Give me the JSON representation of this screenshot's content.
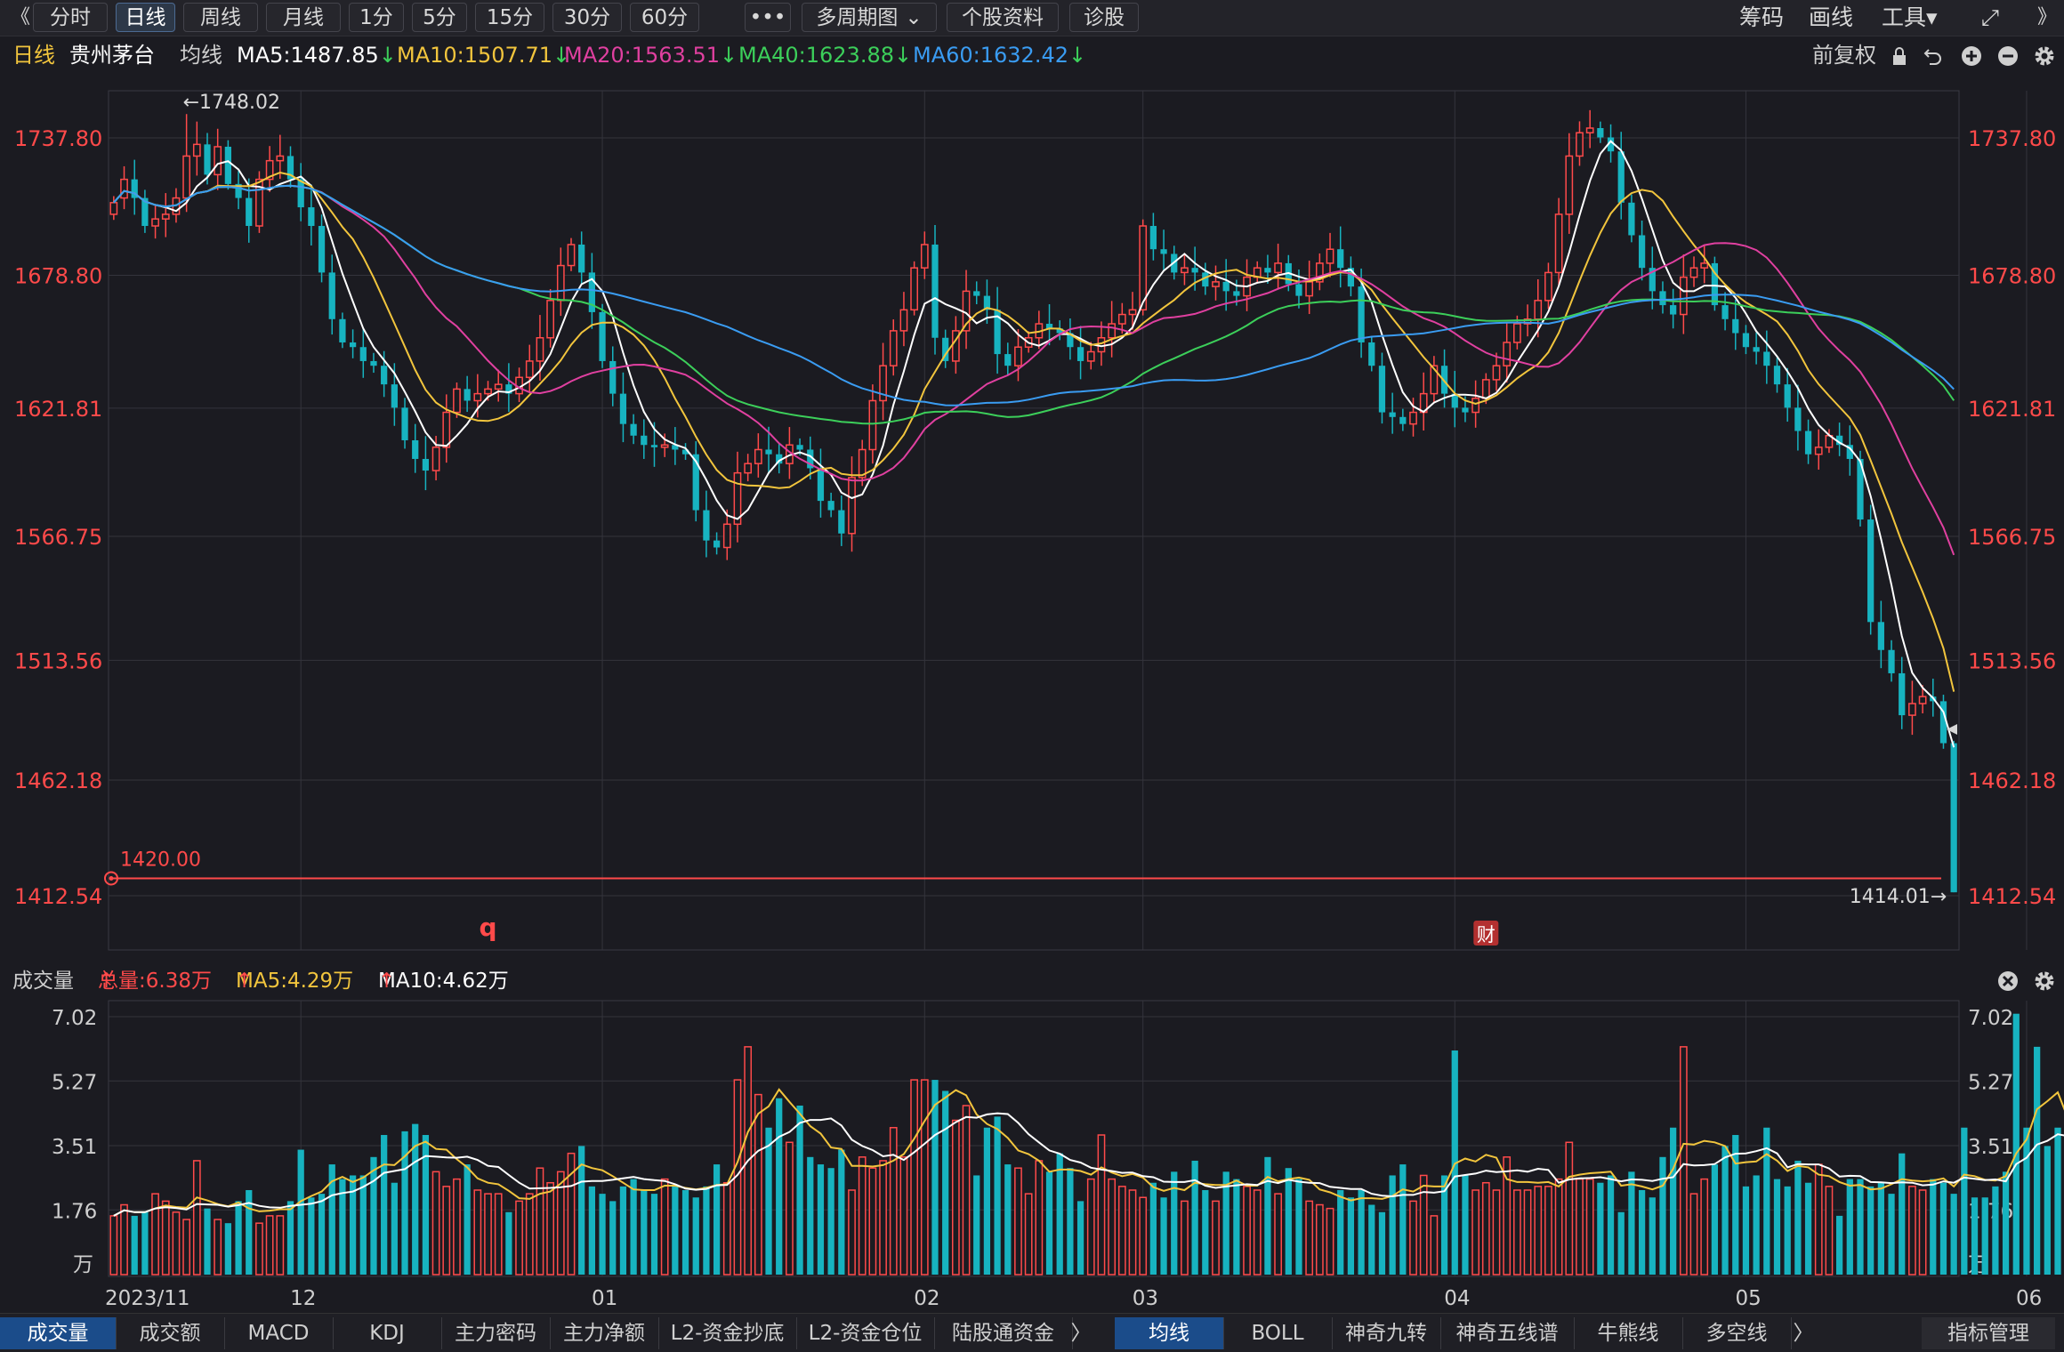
{
  "toolbar": {
    "back": "《",
    "periods": [
      "分时",
      "日线",
      "周线",
      "月线",
      "1分",
      "5分",
      "15分",
      "30分",
      "60分"
    ],
    "active_period": "日线",
    "more": "•••",
    "multi": "多周期图",
    "multi_arrow": "⌄",
    "profile": "个股资料",
    "diagnose": "诊股",
    "chips": "筹码",
    "draw": "画线",
    "tools": "工具",
    "tools_arrow": "▾",
    "expand": "⤢",
    "forward": "》"
  },
  "info": {
    "period": "日线",
    "stock": "贵州茅台",
    "avg_label": "均线",
    "ma": [
      {
        "label": "MA5:1487.85",
        "color": "#ffffff"
      },
      {
        "label": "MA10:1507.71",
        "color": "#f2c53d"
      },
      {
        "label": "MA20:1563.51",
        "color": "#e040a0"
      },
      {
        "label": "MA40:1623.88",
        "color": "#3ccf5a"
      },
      {
        "label": "MA60:1632.42",
        "color": "#3a9cf2"
      }
    ],
    "down_arrow": "↓",
    "adjust": "前复权"
  },
  "vol_info": {
    "title": "成交量",
    "total": "总量:6.38万",
    "ma5": "MA5:4.29万",
    "ma10": "MA10:4.62万",
    "up_arrow": "↑"
  },
  "colors": {
    "up": "#ff4a4a",
    "down": "#17b3c0",
    "grid": "#34343c",
    "bg": "#1b1b21",
    "ma5": "#ffffff",
    "ma10": "#f2c53d",
    "ma20": "#e040a0",
    "ma40": "#3ccf5a",
    "ma60": "#3a9cf2"
  },
  "chart_data": [
    {
      "type": "candlestick",
      "ylim": [
        1412.54,
        1737.8
      ],
      "yticks": [
        "1737.80",
        "1678.80",
        "1621.81",
        "1566.75",
        "1513.56",
        "1462.18",
        "1412.54"
      ],
      "months": [
        {
          "label": "2023/11",
          "index": 0
        },
        {
          "label": "12",
          "index": 18
        },
        {
          "label": "01",
          "index": 47
        },
        {
          "label": "02",
          "index": 78
        },
        {
          "label": "03",
          "index": 99
        },
        {
          "label": "04",
          "index": 129
        },
        {
          "label": "05",
          "index": 157
        },
        {
          "label": "06",
          "index": 184
        }
      ],
      "annotations": {
        "high_label": "←1748.02",
        "low_label": "1414.01→",
        "alert_price": 1420.0,
        "alert_label": "1420.00",
        "markers": [
          {
            "text": "q",
            "index": 36
          },
          {
            "text": "财",
            "index": 132
          },
          {
            "text": "q",
            "index": 200
          }
        ]
      },
      "close": [
        1710,
        1720,
        1712,
        1700,
        1703,
        1705,
        1712,
        1730,
        1735,
        1722,
        1734,
        1718,
        1712,
        1700,
        1720,
        1728,
        1730,
        1720,
        1708,
        1700,
        1680,
        1660,
        1650,
        1648,
        1642,
        1640,
        1632,
        1622,
        1608,
        1600,
        1595,
        1605,
        1620,
        1630,
        1625,
        1628,
        1630,
        1632,
        1628,
        1635,
        1642,
        1652,
        1668,
        1683,
        1692,
        1680,
        1663,
        1642,
        1628,
        1615,
        1610,
        1606,
        1605,
        1606,
        1604,
        1602,
        1578,
        1565,
        1562,
        1572,
        1594,
        1598,
        1604,
        1602,
        1598,
        1606,
        1604,
        1596,
        1582,
        1578,
        1568,
        1592,
        1604,
        1625,
        1640,
        1655,
        1664,
        1682,
        1692,
        1652,
        1642,
        1655,
        1672,
        1670,
        1664,
        1645,
        1640,
        1648,
        1652,
        1658,
        1656,
        1654,
        1648,
        1642,
        1646,
        1652,
        1658,
        1662,
        1664,
        1700,
        1690,
        1688,
        1680,
        1682,
        1680,
        1674,
        1676,
        1672,
        1670,
        1678,
        1682,
        1680,
        1684,
        1675,
        1670,
        1676,
        1684,
        1690,
        1682,
        1674,
        1650,
        1640,
        1620,
        1618,
        1615,
        1620,
        1628,
        1640,
        1628,
        1622,
        1620,
        1626,
        1634,
        1640,
        1650,
        1658,
        1660,
        1668,
        1680,
        1705,
        1730,
        1740,
        1742,
        1738,
        1732,
        1710,
        1696,
        1682,
        1672,
        1666,
        1662,
        1678,
        1682,
        1684,
        1666,
        1660,
        1654,
        1648,
        1646,
        1640,
        1632,
        1622,
        1612,
        1602,
        1605,
        1610,
        1606,
        1600,
        1574,
        1530,
        1518,
        1508,
        1490,
        1495,
        1498,
        1496,
        1478,
        1414
      ],
      "open": [
        1705,
        1712,
        1720,
        1712,
        1700,
        1703,
        1705,
        1712,
        1730,
        1735,
        1722,
        1734,
        1718,
        1712,
        1700,
        1720,
        1728,
        1730,
        1720,
        1708,
        1700,
        1680,
        1660,
        1650,
        1648,
        1642,
        1640,
        1632,
        1622,
        1608,
        1600,
        1595,
        1605,
        1620,
        1630,
        1625,
        1628,
        1630,
        1632,
        1628,
        1635,
        1642,
        1652,
        1668,
        1683,
        1692,
        1680,
        1663,
        1642,
        1628,
        1615,
        1610,
        1606,
        1605,
        1606,
        1604,
        1602,
        1578,
        1565,
        1562,
        1572,
        1594,
        1598,
        1604,
        1602,
        1598,
        1606,
        1604,
        1596,
        1582,
        1578,
        1568,
        1592,
        1604,
        1625,
        1640,
        1655,
        1664,
        1682,
        1692,
        1652,
        1642,
        1655,
        1672,
        1670,
        1664,
        1645,
        1640,
        1648,
        1652,
        1658,
        1656,
        1654,
        1648,
        1642,
        1646,
        1652,
        1658,
        1662,
        1664,
        1700,
        1690,
        1688,
        1680,
        1682,
        1680,
        1674,
        1676,
        1672,
        1670,
        1678,
        1682,
        1680,
        1684,
        1675,
        1670,
        1676,
        1684,
        1690,
        1682,
        1674,
        1650,
        1640,
        1620,
        1618,
        1615,
        1620,
        1628,
        1640,
        1628,
        1622,
        1620,
        1626,
        1634,
        1640,
        1650,
        1658,
        1660,
        1668,
        1680,
        1705,
        1730,
        1740,
        1742,
        1738,
        1732,
        1710,
        1696,
        1682,
        1672,
        1666,
        1662,
        1678,
        1682,
        1684,
        1666,
        1660,
        1654,
        1648,
        1646,
        1640,
        1632,
        1622,
        1612,
        1602,
        1605,
        1610,
        1606,
        1600,
        1574,
        1530,
        1518,
        1508,
        1490,
        1495,
        1498,
        1496,
        1478
      ],
      "volume": [
        1.6,
        1.9,
        1.6,
        1.7,
        2.2,
        2.0,
        1.7,
        1.5,
        3.1,
        1.8,
        1.5,
        1.4,
        2.0,
        2.3,
        1.4,
        1.6,
        1.6,
        2.0,
        3.4,
        2.1,
        2.2,
        3.0,
        2.6,
        2.7,
        2.7,
        3.2,
        3.8,
        2.5,
        3.9,
        4.1,
        3.8,
        2.8,
        2.4,
        2.6,
        3.0,
        2.3,
        2.2,
        2.2,
        1.7,
        2.0,
        2.2,
        2.9,
        2.5,
        2.8,
        3.3,
        3.5,
        2.4,
        2.2,
        2.0,
        2.4,
        2.6,
        2.3,
        2.2,
        2.6,
        2.4,
        2.3,
        2.1,
        2.4,
        3.0,
        2.5,
        5.3,
        6.2,
        4.9,
        4.0,
        4.8,
        3.6,
        4.6,
        3.2,
        3.0,
        2.9,
        3.4,
        2.3,
        3.2,
        2.9,
        3.1,
        4.0,
        3.2,
        5.3,
        5.3,
        5.3,
        5.0,
        4.2,
        4.6,
        2.7,
        4.0,
        4.3,
        3.0,
        2.9,
        2.2,
        3.1,
        2.8,
        3.3,
        2.9,
        2.0,
        2.6,
        3.8,
        2.6,
        2.4,
        2.3,
        2.1,
        2.5,
        2.1,
        2.8,
        2.0,
        3.1,
        2.3,
        2.0,
        2.8,
        2.6,
        2.4,
        2.3,
        3.2,
        2.2,
        2.9,
        2.6,
        2.0,
        1.9,
        1.8,
        2.3,
        2.1,
        2.3,
        1.9,
        1.7,
        2.7,
        3.0,
        2.0,
        2.7,
        1.6,
        2.7,
        6.1,
        2.7,
        2.3,
        2.5,
        2.3,
        3.2,
        2.3,
        2.3,
        2.4,
        2.4,
        2.6,
        3.6,
        2.6,
        2.6,
        2.5,
        2.7,
        1.7,
        2.8,
        2.3,
        2.1,
        3.2,
        4.0,
        6.2,
        2.2,
        2.6,
        3.0,
        3.5,
        3.8,
        2.4,
        2.7,
        4.0,
        2.6,
        2.4,
        3.1,
        2.5,
        3.0,
        2.4,
        1.6,
        2.6,
        2.6,
        2.4,
        2.5,
        2.2,
        3.3,
        2.4,
        2.3,
        2.6,
        2.5,
        2.2,
        4.0,
        2.1,
        2.1,
        2.4,
        2.8,
        7.1,
        4.0,
        6.2,
        3.5,
        4.0,
        3.5,
        3.3,
        3.0,
        2.6,
        6.6
      ]
    },
    {
      "type": "bar",
      "title": "成交量",
      "unit": "万",
      "ylim": [
        0,
        7.02
      ],
      "yticks": [
        "7.02",
        "5.27",
        "3.51",
        "1.76"
      ]
    }
  ],
  "bottom_tabs_left": [
    "成交量",
    "成交额",
    "MACD",
    "KDJ",
    "主力密码",
    "主力净额",
    "L2-资金抄底",
    "L2-资金仓位",
    "陆股通资金"
  ],
  "bottom_tabs_right": [
    "均线",
    "BOLL",
    "神奇九转",
    "神奇五线谱",
    "牛熊线",
    "多空线"
  ],
  "bottom_more": "〉",
  "bottom_manage": "指标管理"
}
